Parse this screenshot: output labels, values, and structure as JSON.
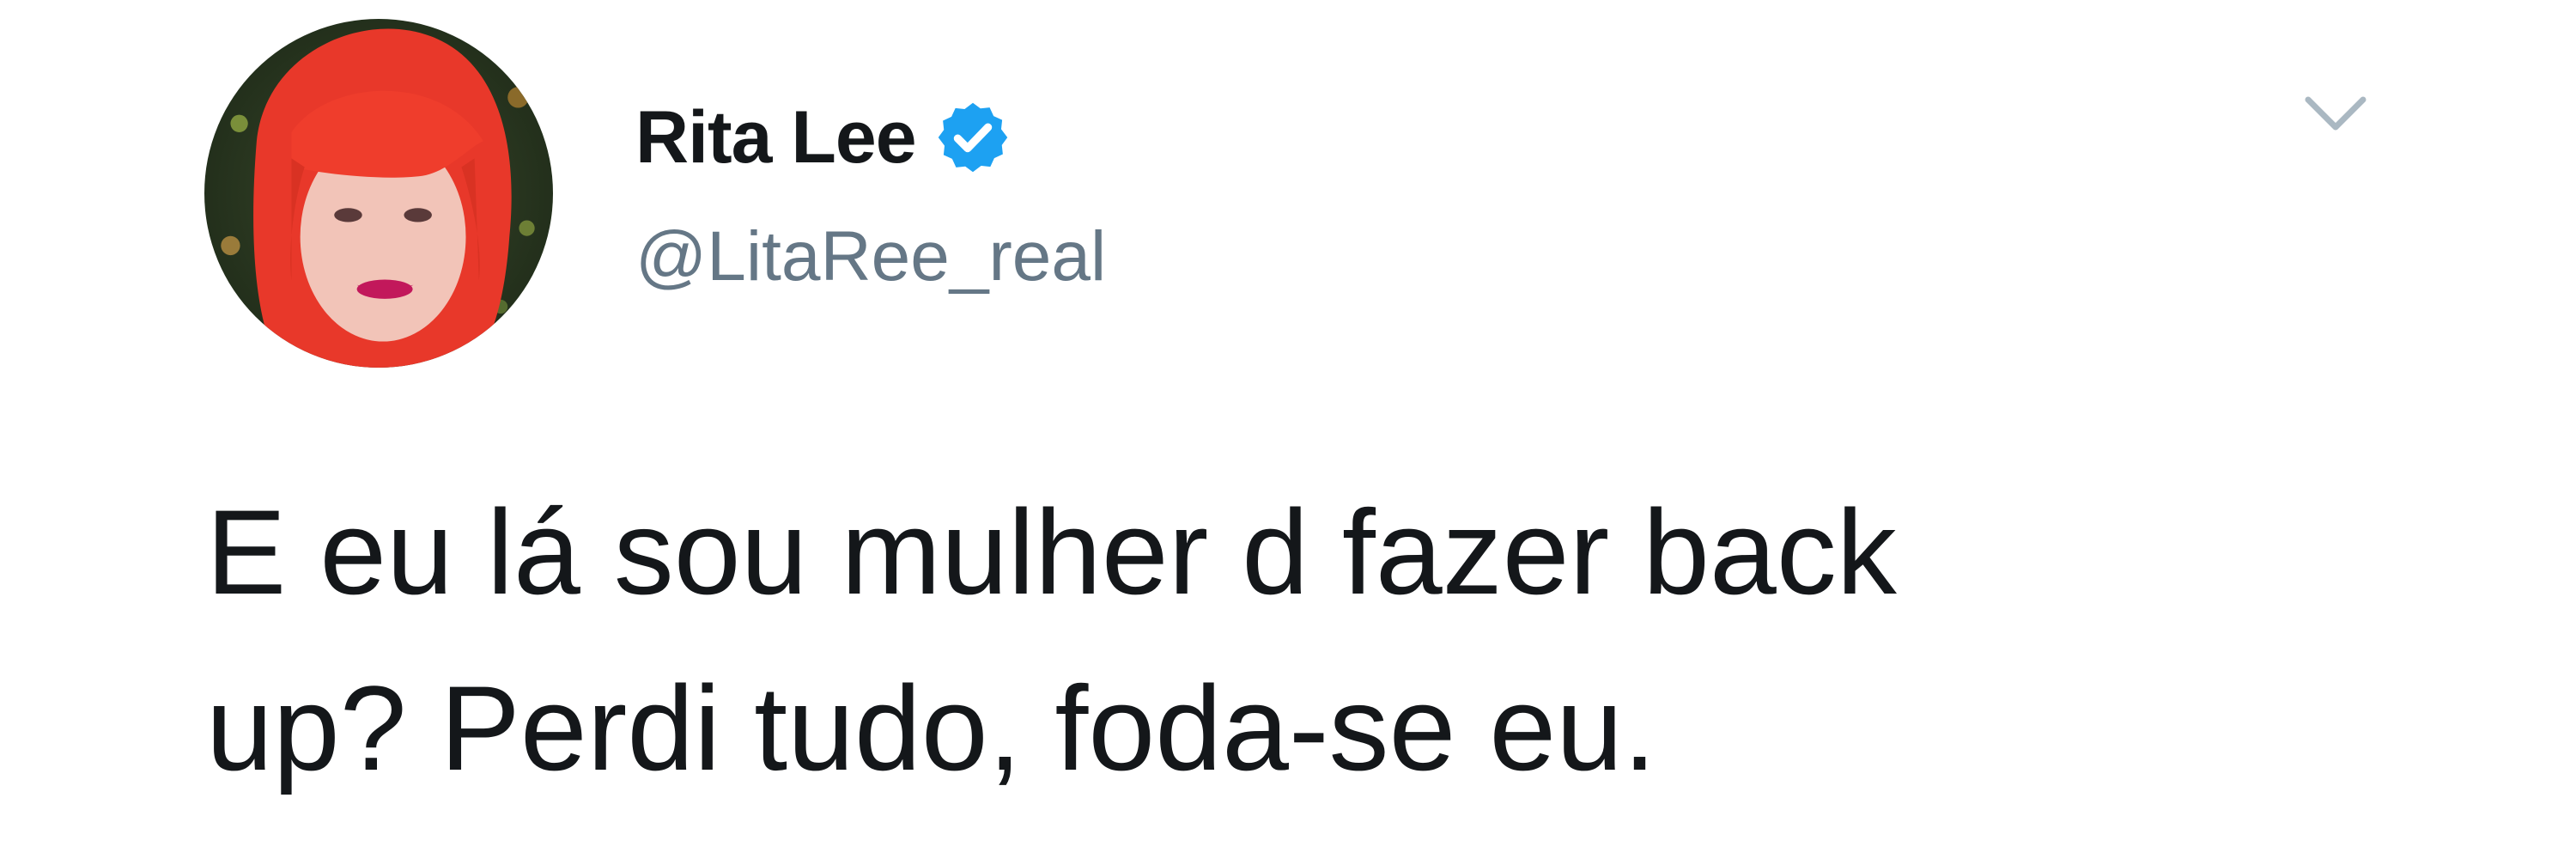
{
  "tweet": {
    "author": {
      "display_name": "Rita Lee",
      "handle": "@LitaRee_real",
      "verified": true,
      "avatar_icon": "profile-photo"
    },
    "menu_icon": "chevron-down-icon",
    "text_line1": "E eu lá sou mulher d fazer back",
    "text_line2": "up? Perdi tudo, foda-se eu."
  },
  "colors": {
    "text": "#14171a",
    "handle": "#657786",
    "verified_blue": "#1da1f2",
    "caret": "#aab8c2"
  }
}
